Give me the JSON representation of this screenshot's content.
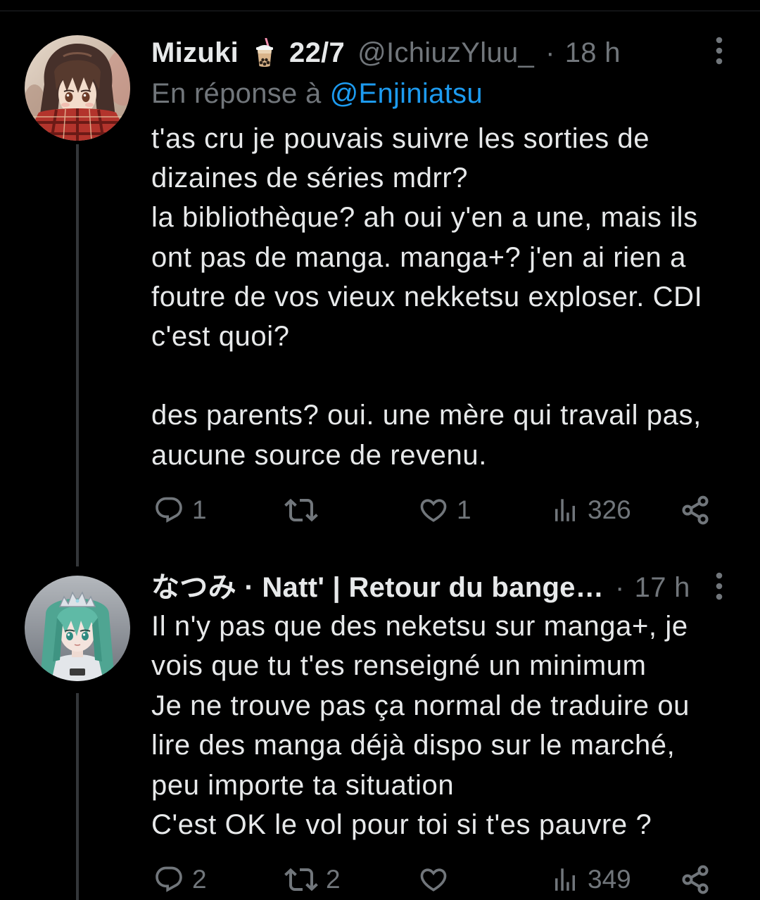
{
  "theme": {
    "background": "#000000",
    "text": "#e7e9ea",
    "muted": "#71767b",
    "link": "#1d9bf0",
    "thread_line": "#333639"
  },
  "icons": {
    "reply": "reply-icon",
    "retweet": "retweet-icon",
    "like": "heart-icon",
    "views": "views-chart-icon",
    "share": "share-icon",
    "more": "more-vertical-icon",
    "name_emoji": "bubble-tea-icon"
  },
  "tweets": [
    {
      "author": {
        "name_part1": "Mizuki",
        "name_part2": "22/7",
        "handle": "@IchiuzYluu_"
      },
      "separator": "·",
      "time": "18 h",
      "reply_to": {
        "prefix": "En réponse à",
        "handle": "@Enjiniatsu"
      },
      "paragraphs": [
        [
          "t'as cru je pouvais suivre les sorties de",
          "dizaines de séries mdrr?",
          "la bibliothèque? ah oui y'en a une, mais ils",
          "ont pas de manga. manga+? j'en ai rien a",
          "foutre de vos vieux nekketsu exploser. CDI",
          "c'est quoi?"
        ],
        [
          "des parents? oui. une mère qui travail pas,",
          "aucune source de revenu."
        ]
      ],
      "actions": {
        "replies": "1",
        "likes": "1",
        "views": "326"
      }
    },
    {
      "author": {
        "name": "なつみ · Natt' | Retour du bange…"
      },
      "separator": "·",
      "time": "17 h",
      "paragraphs": [
        [
          "Il n'y pas que des neketsu sur manga+, je",
          "vois que tu t'es renseigné un minimum",
          "Je ne trouve pas ça normal de traduire ou",
          "lire des manga déjà dispo sur le marché,",
          "peu importe ta situation",
          "C'est OK le vol pour toi si t'es pauvre ?"
        ]
      ],
      "actions": {
        "replies": "2",
        "retweets": "2",
        "views": "349"
      }
    }
  ]
}
